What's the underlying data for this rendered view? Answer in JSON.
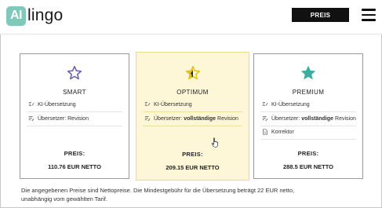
{
  "header": {
    "logo_ai": "AI",
    "logo_text": "lingo",
    "preis_button": "PREIS",
    "menu_icon": "hamburger-menu-icon"
  },
  "plans": [
    {
      "name": "SMART",
      "icon": "star-outline-icon",
      "star_color": "#6a5ba8",
      "features": [
        {
          "icon": "ai-translate-icon",
          "text": "KI-Übersetzung"
        },
        {
          "icon": "revision-icon",
          "text": "Übersetzer: Revision"
        }
      ],
      "price_label": "PREIS:",
      "price": "110.76 EUR NETTO"
    },
    {
      "name": "OPTIMUM",
      "icon": "star-half-icon",
      "star_color": "#e2c21a",
      "highlighted": true,
      "features": [
        {
          "icon": "ai-translate-icon",
          "text": "KI-Übersetzung"
        },
        {
          "icon": "revision-icon",
          "text_prefix": "Übersetzer:",
          "text_bold": "vollständige",
          "text_suffix": "Revision"
        }
      ],
      "price_label": "PREIS:",
      "price": "209.15 EUR NETTO"
    },
    {
      "name": "PREMIUM",
      "icon": "star-filled-icon",
      "star_color": "#3aaea0",
      "features": [
        {
          "icon": "ai-translate-icon",
          "text": "KI-Übersetzung"
        },
        {
          "icon": "revision-icon",
          "text_prefix": "Übersetzer:",
          "text_bold": "vollständige",
          "text_suffix": "Revision"
        },
        {
          "icon": "document-icon",
          "text": "Korrektor"
        }
      ],
      "price_label": "PREIS:",
      "price": "288.5 EUR NETTO"
    }
  ],
  "footnote": {
    "line1": "Die angegebenen Preise sind Nettopreise. Die Mindestgebühr für die Übersetzung beträgt 22 EUR netto,",
    "line2": "unabhängig vom gewählten Tarif."
  },
  "colors": {
    "logo_accent": "#7fc8ba",
    "highlight_bg": "#fdf7d8",
    "highlight_border": "#ecdd86"
  }
}
